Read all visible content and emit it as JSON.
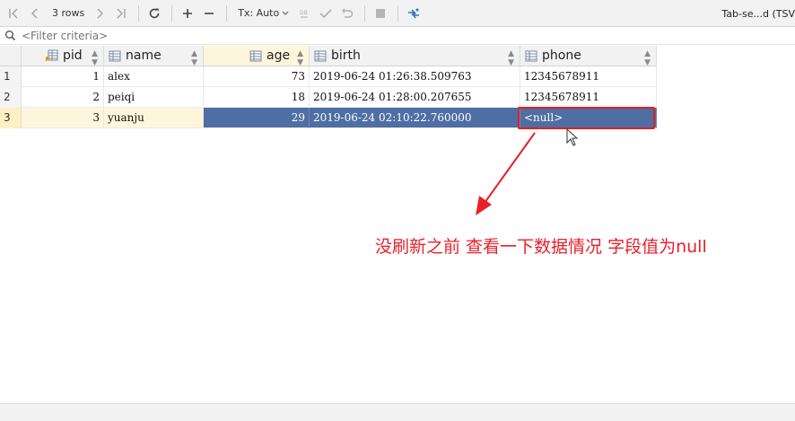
{
  "toolbar": {
    "first_icon": "first-page-icon",
    "prev_icon": "prev-page-icon",
    "rows_label": "3 rows",
    "next_icon": "next-page-icon",
    "last_icon": "last-page-icon",
    "refresh_icon": "refresh-icon",
    "add_icon": "add-row-icon",
    "remove_icon": "remove-row-icon",
    "tx_label": "Tx: Auto",
    "commit_icon": "commit-icon",
    "revert_icon": "revert-icon",
    "stop_icon": "stop-icon",
    "compare_icon": "compare-icon",
    "tab_label": "Tab-se...d (TSV"
  },
  "filter": {
    "placeholder": "<Filter criteria>",
    "icon": "filter-search-icon"
  },
  "table": {
    "columns": [
      {
        "label": "pid"
      },
      {
        "label": "name"
      },
      {
        "label": "age"
      },
      {
        "label": "birth"
      },
      {
        "label": "phone"
      }
    ],
    "rows": [
      {
        "num": "1",
        "pid": "1",
        "name": "alex",
        "age": "73",
        "birth": "2019-06-24 01:26:38.509763",
        "phone": "12345678911"
      },
      {
        "num": "2",
        "pid": "2",
        "name": "peiqi",
        "age": "18",
        "birth": "2019-06-24 01:28:00.207655",
        "phone": "12345678911"
      },
      {
        "num": "3",
        "pid": "3",
        "name": "yuanju",
        "age": "29",
        "birth": "2019-06-24 02:10:22.760000",
        "phone": "<null>"
      }
    ]
  },
  "annotation": {
    "text": "没刷新之前 查看一下数据情况 字段值为null",
    "color": "#e8202a"
  },
  "colors": {
    "selection": "#4f6ea4",
    "current_row": "#fdf6dc",
    "highlight_box": "#e02020"
  }
}
